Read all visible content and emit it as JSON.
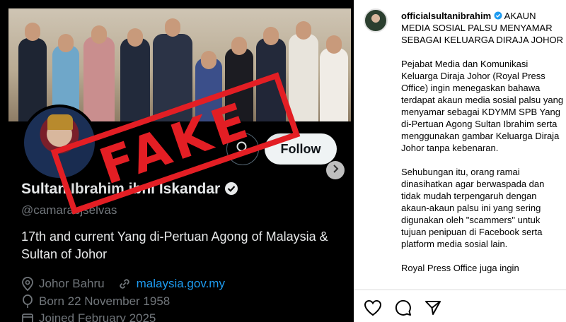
{
  "post_image": {
    "profile": {
      "display_name": "Sultan Ibrahim ibni Iskandar",
      "handle": "@camarabjselvas",
      "bio": "17th and current Yang di-Pertuan Agong of Malaysia & Sultan of Johor",
      "location": "Johor Bahru",
      "website": "malaysia.gov.my",
      "born": "Born 22 November 1958",
      "joined": "Joined February 2025",
      "follow_label": "Follow"
    },
    "stamp_text": "FAKE"
  },
  "caption": {
    "username": "officialsultanibrahim",
    "headline": "AKAUN MEDIA SOSIAL PALSU MENYAMAR SEBAGAI KELUARGA DIRAJA JOHOR",
    "paragraph_1": "Pejabat Media dan Komunikasi Keluarga Diraja Johor (Royal Press Office) ingin menegaskan bahawa terdapat akaun media sosial palsu yang menyamar sebagai KDYMM SPB Yang di-Pertuan Agong Sultan Ibrahim serta menggunakan gambar Keluarga Diraja Johor tanpa kebenaran.",
    "paragraph_2": "Sehubungan itu, orang ramai dinasihatkan agar berwaspada dan tidak mudah terpengaruh dengan akaun-akaun palsu ini yang sering digunakan oleh \"scammers\" untuk tujuan penipuan di Facebook serta platform media sosial lain.",
    "paragraph_3": "Royal Press Office juga ingin"
  },
  "icons": [
    "search-icon",
    "verified-icon",
    "location-icon",
    "link-icon",
    "balloon-icon",
    "calendar-icon",
    "chevron-right-icon",
    "heart-icon",
    "comment-icon",
    "share-icon"
  ],
  "colors": {
    "stamp": "#e31e24",
    "link": "#1d9bf0",
    "verified": "#1d9bf0"
  }
}
